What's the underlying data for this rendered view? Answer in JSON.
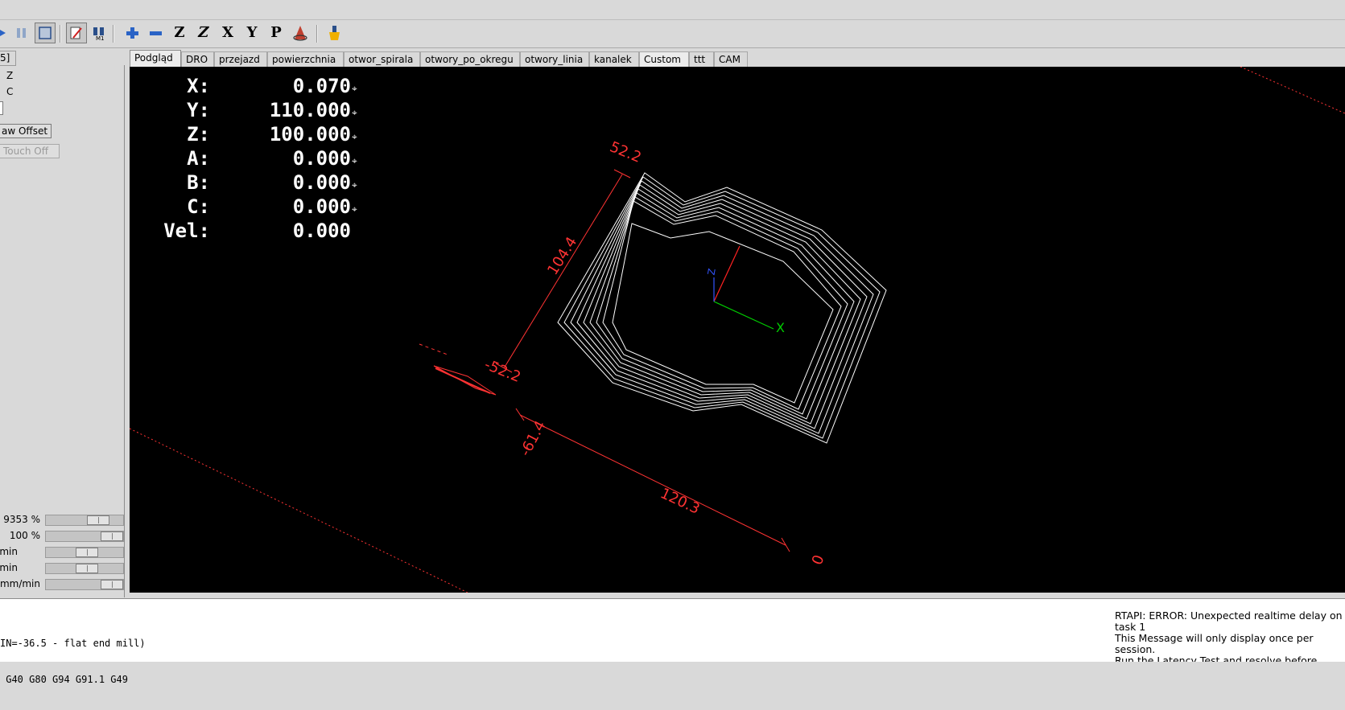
{
  "toolbar": {
    "buttons": [
      {
        "name": "run-icon"
      },
      {
        "name": "pause-icon"
      },
      {
        "name": "stop-icon"
      },
      {
        "name": "block-delete-icon"
      },
      {
        "name": "optional-stop-icon"
      },
      {
        "name": "zoom-in-icon"
      },
      {
        "name": "zoom-out-icon"
      },
      {
        "name": "view-z-icon",
        "glyph": "Z"
      },
      {
        "name": "view-z2-icon",
        "glyph": "Z"
      },
      {
        "name": "view-x-icon",
        "glyph": "X"
      },
      {
        "name": "view-y-icon",
        "glyph": "Y"
      },
      {
        "name": "view-p-icon",
        "glyph": "P"
      },
      {
        "name": "rotate-icon"
      },
      {
        "name": "clear-plot-icon"
      }
    ]
  },
  "left_panel": {
    "tab_label": "5]",
    "axis_options": [
      "Z",
      "C"
    ],
    "draw_offset_label": "aw Offset",
    "touch_off_label": "Touch Off",
    "overrides": [
      {
        "label": "9353 %",
        "value_fraction": 0.75
      },
      {
        "label": "100 %",
        "value_fraction": 1.0
      },
      {
        "label": "/min",
        "value_fraction": 0.55
      },
      {
        "label": "min",
        "value_fraction": 0.55
      },
      {
        "label": "mm/min",
        "value_fraction": 1.0
      }
    ]
  },
  "tabs": [
    {
      "label": "Podgląd",
      "active": true
    },
    {
      "label": "DRO"
    },
    {
      "label": "przejazd"
    },
    {
      "label": "powierzchnia"
    },
    {
      "label": "otwor_spirala"
    },
    {
      "label": "otwory_po_okregu"
    },
    {
      "label": "otwory_linia"
    },
    {
      "label": "kanalek"
    },
    {
      "label": "Custom"
    },
    {
      "label": "ttt"
    },
    {
      "label": "CAM"
    }
  ],
  "dro": [
    {
      "label": "X:",
      "value": "0.070",
      "homed": true
    },
    {
      "label": "Y:",
      "value": "110.000",
      "homed": true
    },
    {
      "label": "Z:",
      "value": "100.000",
      "homed": true
    },
    {
      "label": "A:",
      "value": "0.000",
      "homed": true
    },
    {
      "label": "B:",
      "value": "0.000",
      "homed": true
    },
    {
      "label": "C:",
      "value": "0.000",
      "homed": true
    },
    {
      "label": "Vel:",
      "value": "0.000",
      "homed": false
    }
  ],
  "homed_glyph": "⌖",
  "dimensions": {
    "top_width": "52.2",
    "left_height": "104.4",
    "left_neg": "-52.2",
    "bottom_neg": "-61.4",
    "bottom_length": "120.3",
    "bottom_end": "0"
  },
  "axes_labels": {
    "x": "X",
    "z": "Z"
  },
  "colors": {
    "viewport_bg": "#000000",
    "dimension": "#ff3333",
    "toolpath": "#ffffff",
    "x_axis": "#00cc00",
    "z_axis": "#3355ff",
    "y_axis": "#ff2222"
  },
  "gcode_lines": [
    "IN=-36.5 - flat end mill)",
    " G40 G80 G94 G91.1 G49"
  ],
  "error_messages": [
    "RTAPI: ERROR: Unexpected realtime delay on task 1",
    "This Message will only display once per session.",
    "Run the Latency Test and resolve before continuing."
  ]
}
